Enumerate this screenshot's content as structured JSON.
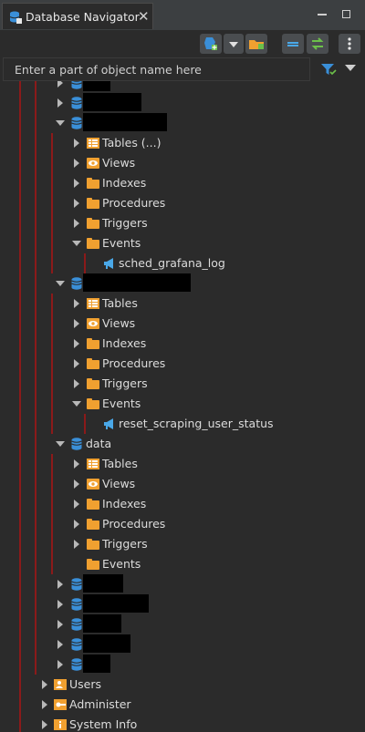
{
  "tab": {
    "title": "Database Navigator",
    "close": "✕"
  },
  "search": {
    "placeholder": "Enter a part of object name here"
  },
  "colors": {
    "guide": "#8b1a1a",
    "db_icon": "#3a8fd8",
    "folder": "#f0a030",
    "event": "#4aa8e8"
  },
  "tree": [
    {
      "type": "db",
      "level": 1,
      "expanded": false,
      "label": "",
      "redacted": true,
      "redact_w": 30
    },
    {
      "type": "db",
      "level": 1,
      "expanded": false,
      "label": "",
      "redacted": true,
      "redact_w": 64
    },
    {
      "type": "db",
      "level": 1,
      "expanded": true,
      "label": "",
      "redacted": true,
      "redact_w": 92
    },
    {
      "type": "folder",
      "level": 2,
      "expanded": false,
      "label": "Tables (...)",
      "icon": "tables-icon"
    },
    {
      "type": "folder",
      "level": 2,
      "expanded": false,
      "label": "Views",
      "icon": "views-icon"
    },
    {
      "type": "folder",
      "level": 2,
      "expanded": false,
      "label": "Indexes",
      "icon": "folder-icon"
    },
    {
      "type": "folder",
      "level": 2,
      "expanded": false,
      "label": "Procedures",
      "icon": "folder-icon"
    },
    {
      "type": "folder",
      "level": 2,
      "expanded": false,
      "label": "Triggers",
      "icon": "folder-icon"
    },
    {
      "type": "folder",
      "level": 2,
      "expanded": true,
      "label": "Events",
      "icon": "folder-icon"
    },
    {
      "type": "event",
      "level": 3,
      "label": "sched_grafana_log"
    },
    {
      "type": "db",
      "level": 1,
      "expanded": true,
      "label": "",
      "redacted": true,
      "redact_w": 118
    },
    {
      "type": "folder",
      "level": 2,
      "expanded": false,
      "label": "Tables",
      "icon": "tables-icon"
    },
    {
      "type": "folder",
      "level": 2,
      "expanded": false,
      "label": "Views",
      "icon": "views-icon"
    },
    {
      "type": "folder",
      "level": 2,
      "expanded": false,
      "label": "Indexes",
      "icon": "folder-icon"
    },
    {
      "type": "folder",
      "level": 2,
      "expanded": false,
      "label": "Procedures",
      "icon": "folder-icon"
    },
    {
      "type": "folder",
      "level": 2,
      "expanded": false,
      "label": "Triggers",
      "icon": "folder-icon"
    },
    {
      "type": "folder",
      "level": 2,
      "expanded": true,
      "label": "Events",
      "icon": "folder-icon"
    },
    {
      "type": "event",
      "level": 3,
      "label": "reset_scraping_user_status"
    },
    {
      "type": "db",
      "level": 1,
      "expanded": true,
      "label": "data",
      "redacted": false
    },
    {
      "type": "folder",
      "level": 2,
      "expanded": false,
      "label": "Tables",
      "icon": "tables-icon"
    },
    {
      "type": "folder",
      "level": 2,
      "expanded": false,
      "label": "Views",
      "icon": "views-icon"
    },
    {
      "type": "folder",
      "level": 2,
      "expanded": false,
      "label": "Indexes",
      "icon": "folder-icon"
    },
    {
      "type": "folder",
      "level": 2,
      "expanded": false,
      "label": "Procedures",
      "icon": "folder-icon"
    },
    {
      "type": "folder",
      "level": 2,
      "expanded": false,
      "label": "Triggers",
      "icon": "folder-icon"
    },
    {
      "type": "folder",
      "level": 2,
      "expanded": null,
      "label": "Events",
      "icon": "folder-icon"
    },
    {
      "type": "db",
      "level": 1,
      "expanded": false,
      "label": "",
      "redacted": true,
      "redact_w": 44
    },
    {
      "type": "db",
      "level": 1,
      "expanded": false,
      "label": "",
      "redacted": true,
      "redact_w": 72
    },
    {
      "type": "db",
      "level": 1,
      "expanded": false,
      "label": "",
      "redacted": true,
      "redact_w": 42
    },
    {
      "type": "db",
      "level": 1,
      "expanded": false,
      "label": "",
      "redacted": true,
      "redact_w": 52
    },
    {
      "type": "db",
      "level": 1,
      "expanded": false,
      "label": "",
      "redacted": true,
      "redact_w": 30
    },
    {
      "type": "root",
      "level": 0,
      "expanded": false,
      "label": "Users",
      "icon": "users-icon"
    },
    {
      "type": "root",
      "level": 0,
      "expanded": false,
      "label": "Administer",
      "icon": "administer-icon"
    },
    {
      "type": "root",
      "level": 0,
      "expanded": false,
      "label": "System Info",
      "icon": "info-icon"
    }
  ]
}
